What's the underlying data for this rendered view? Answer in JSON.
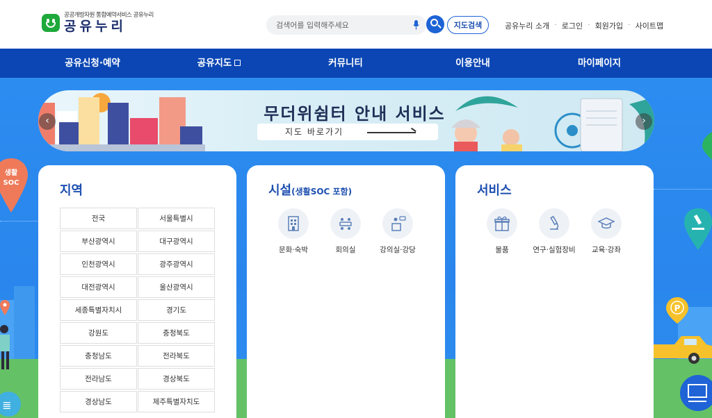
{
  "header": {
    "logo_sub": "공공개방자원 통합예약서비스 공유누리",
    "logo_main": "공유누리",
    "search_placeholder": "검색어를 입력해주세요",
    "map_search_label": "지도검색",
    "util_links": [
      "공유누리 소개",
      "로그인",
      "회원가입",
      "사이트맵"
    ]
  },
  "gnb": {
    "items": [
      "공유신청·예약",
      "공유지도",
      "커뮤니티",
      "이용안내",
      "마이페이지"
    ]
  },
  "banner": {
    "title": "무더위쉼터 안내 서비스",
    "link_label": "지도 바로가기"
  },
  "region_card": {
    "title": "지역",
    "regions": [
      "전국",
      "서울특별시",
      "부산광역시",
      "대구광역시",
      "인천광역시",
      "광주광역시",
      "대전광역시",
      "울산광역시",
      "세종특별자치시",
      "경기도",
      "강원도",
      "충청북도",
      "충청남도",
      "전라북도",
      "전라남도",
      "경상북도",
      "경상남도",
      "제주특별자치도"
    ]
  },
  "facility_card": {
    "title": "시설",
    "subtitle": "(생활SOC 포함)",
    "items": [
      "문화·숙박",
      "회의실",
      "강의실·강당"
    ]
  },
  "service_card": {
    "title": "서비스",
    "items": [
      "물품",
      "연구·실험장비",
      "교육·강좌"
    ]
  },
  "side": {
    "left_pin_label": "생활 SOC"
  },
  "colors": {
    "brand_blue": "#0b46b4",
    "accent_blue": "#1d63d6",
    "logo_green": "#1fa93a"
  }
}
